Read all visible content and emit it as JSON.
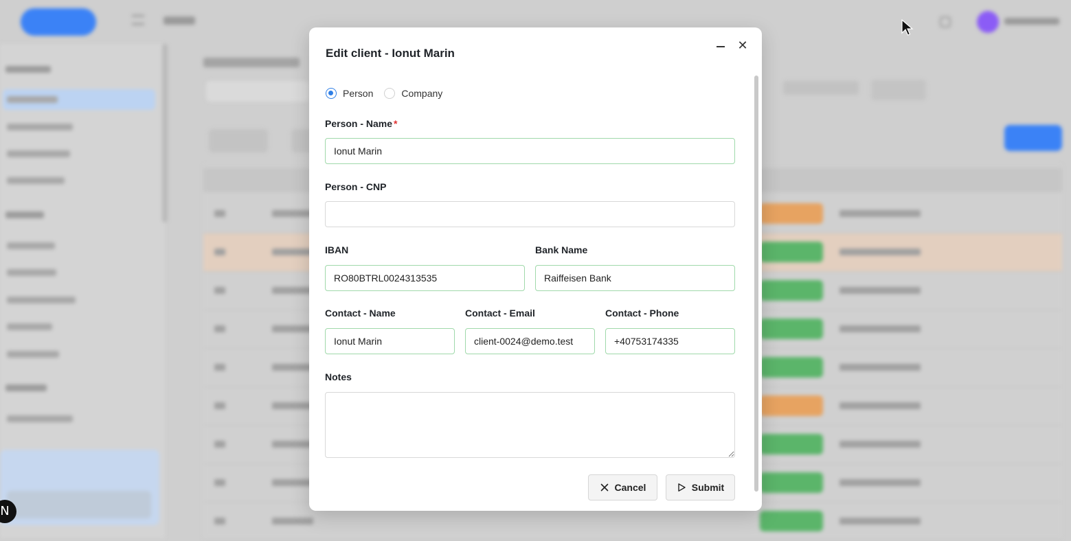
{
  "modal": {
    "title": "Edit client - Ionut Marin",
    "minimize_icon": "minimize-icon",
    "close_icon": "close-icon",
    "type_options": [
      {
        "label": "Person",
        "selected": true
      },
      {
        "label": "Company",
        "selected": false
      }
    ],
    "fields": {
      "person_name": {
        "label": "Person - Name",
        "required_mark": "*",
        "value": "Ionut Marin"
      },
      "person_cnp": {
        "label": "Person - CNP",
        "value": ""
      },
      "iban": {
        "label": "IBAN",
        "value": "RO80BTRL0024313535"
      },
      "bank_name": {
        "label": "Bank Name",
        "value": "Raiffeisen Bank"
      },
      "contact_name": {
        "label": "Contact - Name",
        "value": "Ionut Marin"
      },
      "contact_email": {
        "label": "Contact - Email",
        "value": "client-0024@demo.test"
      },
      "contact_phone": {
        "label": "Contact - Phone",
        "value": "+40753174335"
      },
      "notes": {
        "label": "Notes",
        "value": ""
      }
    },
    "buttons": {
      "cancel": {
        "label": "Cancel",
        "icon": "close-icon"
      },
      "submit": {
        "label": "Submit",
        "icon": "play-icon"
      }
    }
  },
  "colors": {
    "accent": "#2f7fe6",
    "valid_border": "#9fd9aa",
    "required": "#e03131",
    "status_green": "#5bb56a",
    "status_orange": "#e7a361"
  }
}
